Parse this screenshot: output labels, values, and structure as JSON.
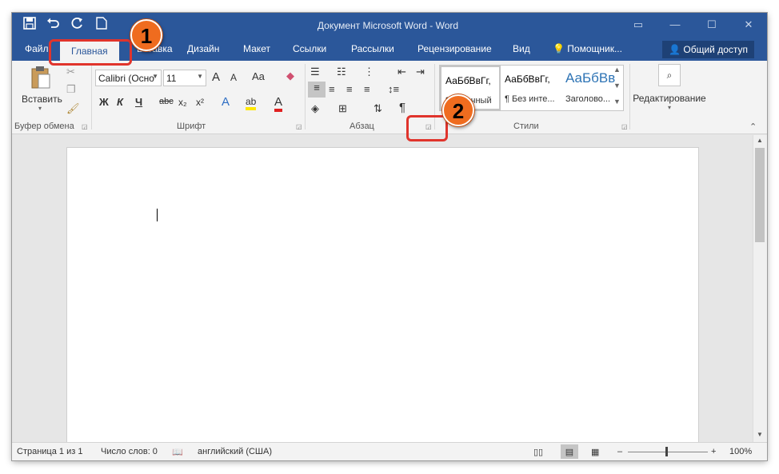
{
  "window": {
    "title": "Документ Microsoft Word - Word"
  },
  "qat": {
    "save_icon": "save-icon",
    "undo_icon": "undo-icon",
    "redo_icon": "redo-icon",
    "new_icon": "new-document-icon"
  },
  "tabs": [
    {
      "label": "Файл"
    },
    {
      "label": "Главная"
    },
    {
      "label": "Вставка"
    },
    {
      "label": "Дизайн"
    },
    {
      "label": "Макет"
    },
    {
      "label": "Ссылки"
    },
    {
      "label": "Рассылки"
    },
    {
      "label": "Рецензирование"
    },
    {
      "label": "Вид"
    },
    {
      "label": "Помощник..."
    }
  ],
  "share_label": "Общий доступ",
  "clipboard": {
    "paste_label": "Вставить",
    "group_label": "Буфер обмена"
  },
  "font": {
    "name_value": "Calibri (Осно",
    "size_value": "11",
    "grow": "A",
    "shrink": "A",
    "case": "Aa",
    "bold": "Ж",
    "italic": "К",
    "underline": "Ч",
    "strike": "abc",
    "subscript": "x₂",
    "superscript": "x²",
    "effects": "A",
    "highlight": "ab",
    "color": "A",
    "group_label": "Шрифт"
  },
  "paragraph": {
    "pilcrow": "¶",
    "group_label": "Абзац"
  },
  "styles": {
    "items": [
      {
        "preview": "АаБбВвГг,",
        "name": "¶ Обычный"
      },
      {
        "preview": "АаБбВвГг,",
        "name": "¶ Без инте..."
      },
      {
        "preview": "АаБбВв",
        "name": "Заголово..."
      }
    ],
    "group_label": "Стили"
  },
  "editing": {
    "label": "Редактирование"
  },
  "status": {
    "page": "Страница 1 из 1",
    "words": "Число слов: 0",
    "language": "английский (США)",
    "zoom": "100%",
    "zoom_minus": "–",
    "zoom_plus": "+"
  },
  "annotations": {
    "badge1": "1",
    "badge2": "2"
  },
  "colors": {
    "accent": "#2b579a",
    "badge": "#ef6c1f",
    "callout": "#e0342c"
  }
}
